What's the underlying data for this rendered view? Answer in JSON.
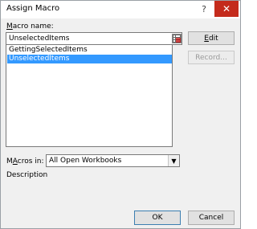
{
  "window": {
    "title": "Assign Macro",
    "help_glyph": "?",
    "close_glyph": "✕"
  },
  "macro_name": {
    "label_accel": "M",
    "label_rest": "acro name:",
    "value": "UnselectedItems"
  },
  "macro_list": {
    "items": [
      {
        "label": "GettingSelectedItems",
        "selected": false
      },
      {
        "label": "UnselectedItems",
        "selected": true
      }
    ]
  },
  "buttons": {
    "edit_accel": "E",
    "edit_rest": "dit",
    "record_label": "Record...",
    "ok_label": "OK",
    "cancel_label": "Cancel"
  },
  "macros_in": {
    "label_accel": "A",
    "label_prefix": "M",
    "label_rest": "cros in:",
    "selected_value": "All Open Workbooks"
  },
  "description": {
    "label": "Description"
  },
  "colors": {
    "selection": "#3399ff",
    "close_button": "#c42b1c"
  }
}
